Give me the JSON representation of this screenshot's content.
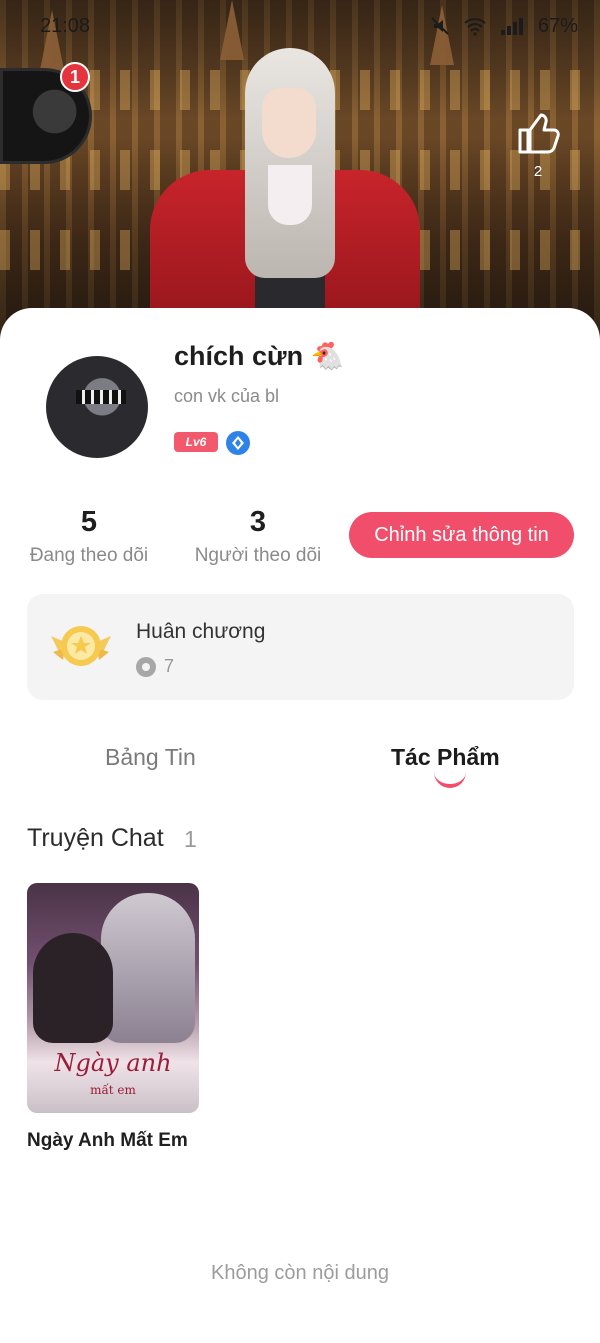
{
  "status_bar": {
    "time": "21:08",
    "battery": "67%"
  },
  "header": {
    "notification_count": "1",
    "like_count": "2"
  },
  "profile": {
    "name": "chích cừn 🐔",
    "bio": "con vk của bl",
    "level": "Lv6"
  },
  "stats": [
    {
      "value": "5",
      "label": "Đang theo dõi"
    },
    {
      "value": "3",
      "label": "Người theo dõi"
    }
  ],
  "actions": {
    "edit_label": "Chỉnh sửa thông tin"
  },
  "medal": {
    "title": "Huân chương",
    "count": "7"
  },
  "tabs": [
    {
      "label": "Bảng Tin",
      "active": false
    },
    {
      "label": "Tác Phẩm",
      "active": true
    }
  ],
  "section": {
    "title": "Truyện Chat",
    "count": "1"
  },
  "stories": [
    {
      "title": "Ngày Anh Mất Em",
      "cover_title": "Ngày anh",
      "cover_subtitle": "mất em"
    }
  ],
  "footer": {
    "note": "Không còn nội dung"
  },
  "colors": {
    "accent": "#f04e6b",
    "level_badge": "#f3596d",
    "verify": "#2f82e8",
    "notification": "#e5343e"
  }
}
